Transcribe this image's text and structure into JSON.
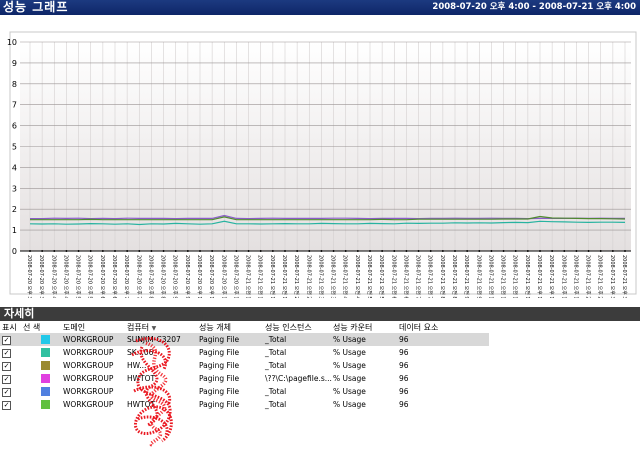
{
  "header": {
    "title": "성능 그래프",
    "range": "2008-07-20 오후 4:00 - 2008-07-21 오후 4:00"
  },
  "chart_data": {
    "type": "line",
    "ylim": [
      0,
      10
    ],
    "yticks": [
      "0",
      "1",
      "2",
      "3",
      "4",
      "5",
      "6",
      "7",
      "8",
      "9",
      "10"
    ],
    "grid": true,
    "x": [
      "2008-07-20 오후 3:15:00",
      "2008-07-20 오후 3:45:00",
      "2008-07-20 오후 4:15:00",
      "2008-07-20 오후 4:45:00",
      "2008-07-20 오후 5:15:00",
      "2008-07-20 오후 5:45:00",
      "2008-07-20 오후 6:15:00",
      "2008-07-20 오후 6:45:00",
      "2008-07-20 오후 7:15:00",
      "2008-07-20 오후 7:45:00",
      "2008-07-20 오후 8:15:00",
      "2008-07-20 오후 8:45:00",
      "2008-07-20 오후 9:15:00",
      "2008-07-20 오후 9:45:00",
      "2008-07-20 오후 10:15:00",
      "2008-07-20 오후 10:45:00",
      "2008-07-20 오후 11:15:00",
      "2008-07-20 오후 11:45:00",
      "2008-07-21 오전 12:15:00",
      "2008-07-21 오전 12:45:00",
      "2008-07-21 오전 1:15:00",
      "2008-07-21 오전 1:45:00",
      "2008-07-21 오전 2:15:00",
      "2008-07-21 오전 2:45:00",
      "2008-07-21 오전 3:15:00",
      "2008-07-21 오전 3:45:00",
      "2008-07-21 오전 4:15:00",
      "2008-07-21 오전 4:45:00",
      "2008-07-21 오전 5:15:00",
      "2008-07-21 오전 5:45:00",
      "2008-07-21 오전 6:15:00",
      "2008-07-21 오전 6:45:00",
      "2008-07-21 오전 7:15:00",
      "2008-07-21 오전 7:45:00",
      "2008-07-21 오전 8:15:00",
      "2008-07-21 오전 8:45:00",
      "2008-07-21 오전 9:15:00",
      "2008-07-21 오전 9:45:00",
      "2008-07-21 오전 10:15:00",
      "2008-07-21 오전 10:45:00",
      "2008-07-21 오전 11:15:00",
      "2008-07-21 오전 11:45:00",
      "2008-07-21 오후 12:15:00",
      "2008-07-21 오후 12:45:00",
      "2008-07-21 오후 1:15:00",
      "2008-07-21 오후 1:45:00",
      "2008-07-21 오후 2:15:00",
      "2008-07-21 오후 2:45:00",
      "2008-07-21 오후 3:15:00",
      "2008-07-21 오후 3:45:00"
    ],
    "series": [
      {
        "color": "#8a5cc8",
        "values": [
          1.55,
          1.55,
          1.57,
          1.56,
          1.57,
          1.55,
          1.56,
          1.55,
          1.57,
          1.56,
          1.56,
          1.56,
          1.55,
          1.56,
          1.56,
          1.56,
          1.7,
          1.56,
          1.55,
          1.56,
          1.57,
          1.56,
          1.56,
          1.56,
          1.56,
          1.57,
          1.57,
          1.56,
          1.55,
          1.56,
          1.56,
          1.56,
          1.55,
          1.56,
          1.56,
          1.57,
          1.56,
          1.56,
          1.57,
          1.56,
          1.56,
          1.55,
          1.56,
          1.56,
          1.56,
          1.57,
          1.56,
          1.57,
          1.56,
          1.56
        ]
      },
      {
        "color": "#4f8a2e",
        "values": [
          1.5,
          1.5,
          1.5,
          1.5,
          1.5,
          1.51,
          1.5,
          1.5,
          1.5,
          1.5,
          1.5,
          1.5,
          1.5,
          1.5,
          1.5,
          1.5,
          1.63,
          1.5,
          1.5,
          1.5,
          1.5,
          1.5,
          1.5,
          1.5,
          1.5,
          1.5,
          1.5,
          1.5,
          1.5,
          1.51,
          1.5,
          1.5,
          1.52,
          1.52,
          1.52,
          1.52,
          1.52,
          1.52,
          1.52,
          1.53,
          1.53,
          1.53,
          1.65,
          1.58,
          1.57,
          1.56,
          1.55,
          1.55,
          1.54,
          1.53
        ]
      },
      {
        "color": "#28b3a0",
        "values": [
          1.3,
          1.29,
          1.3,
          1.28,
          1.29,
          1.31,
          1.3,
          1.28,
          1.3,
          1.27,
          1.3,
          1.29,
          1.32,
          1.3,
          1.28,
          1.3,
          1.42,
          1.3,
          1.3,
          1.29,
          1.3,
          1.31,
          1.3,
          1.3,
          1.32,
          1.31,
          1.3,
          1.3,
          1.32,
          1.31,
          1.3,
          1.33,
          1.32,
          1.33,
          1.33,
          1.35,
          1.34,
          1.35,
          1.34,
          1.36,
          1.37,
          1.36,
          1.42,
          1.4,
          1.39,
          1.38,
          1.37,
          1.38,
          1.38,
          1.37
        ]
      }
    ]
  },
  "details": {
    "section_title": "자세히",
    "columns": [
      "표시",
      "선 색",
      "도메인",
      "컴퓨터",
      "성능 개체",
      "성능 인스턴스",
      "성능 카운터",
      "데이터 요소"
    ],
    "sort_indicator": "▼",
    "rows": [
      {
        "show": "✓",
        "color": "#22c8e8",
        "domain": "WORKGROUP",
        "computer": "SUNJIM-C3207",
        "object": "Paging File",
        "instance": "_Total",
        "counter": "% Usage",
        "points": "96"
      },
      {
        "show": "✓",
        "color": "#30c0a0",
        "domain": "WORKGROUP",
        "computer": "SK...06",
        "object": "Paging File",
        "instance": "_Total",
        "counter": "% Usage",
        "points": "96"
      },
      {
        "show": "✓",
        "color": "#9a8a30",
        "domain": "WORKGROUP",
        "computer": "HW...",
        "object": "Paging File",
        "instance": "_Total",
        "counter": "% Usage",
        "points": "96"
      },
      {
        "show": "✓",
        "color": "#e040e0",
        "domain": "WORKGROUP",
        "computer": "HWTOT",
        "object": "Paging File",
        "instance": "\\??\\C:\\pagefile.s...",
        "counter": "% Usage",
        "points": "96"
      },
      {
        "show": "✓",
        "color": "#5080e0",
        "domain": "WORKGROUP",
        "computer": "",
        "object": "Paging File",
        "instance": "_Total",
        "counter": "% Usage",
        "points": "96"
      },
      {
        "show": "✓",
        "color": "#60c040",
        "domain": "WORKGROUP",
        "computer": "HWTOT",
        "object": "Paging File",
        "instance": "_Total",
        "counter": "% Usage",
        "points": "96"
      }
    ]
  }
}
